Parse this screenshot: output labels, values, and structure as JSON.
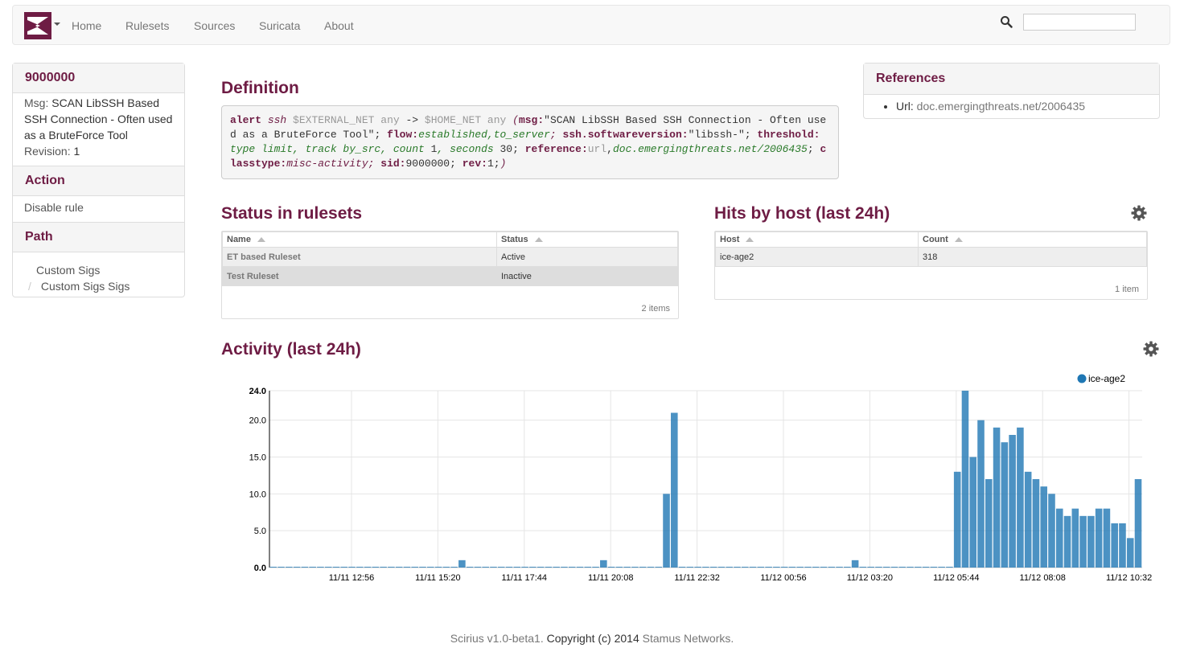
{
  "nav": {
    "items": [
      "Home",
      "Rulesets",
      "Sources",
      "Suricata",
      "About"
    ],
    "search_placeholder": ""
  },
  "sidebar": {
    "sid_title": "9000000",
    "msg_label": "Msg:",
    "msg_value": "SCAN LibSSH Based SSH Connection - Often used as a BruteForce Tool",
    "revision_label": "Revision:",
    "revision_value": "1",
    "action_title": "Action",
    "action_item": "Disable rule",
    "path_title": "Path",
    "path_1": "Custom Sigs",
    "path_sep": "/",
    "path_2": "Custom Sigs Sigs"
  },
  "definition": {
    "title": "Definition",
    "tokens": {
      "alert": "alert",
      "proto": "ssh",
      "src": "$EXTERNAL_NET any",
      "arrow": "->",
      "dst": "$HOME_NET any",
      "open": "(",
      "msg_key": "msg:",
      "msg_val": "\"SCAN LibSSH Based SSH Connection - Often used as a BruteForce Tool\"",
      "semi1": ";",
      "flow_key": "flow:",
      "flow_val": "established,to_server",
      "semi2": ";",
      "sw_key": "ssh.softwareversion:",
      "sw_val": "\"libssh-\"",
      "semi3": ";",
      "thr_key": "threshold:",
      "thr_val1": "type limit, track by_src, count",
      "thr_num1": "1",
      "thr_val2": ", seconds",
      "thr_num2": "30",
      "semi4": ";",
      "ref_key": "reference:",
      "ref_type": "url",
      "ref_comma": ",",
      "ref_val": "doc.emergingthreats.net/2006435",
      "semi5": ";",
      "ct_key": "classtype:",
      "ct_val": "misc-activity",
      "semi6": ";",
      "sid_key": "sid:",
      "sid_val": "9000000",
      "semi7": ";",
      "rev_key": "rev:",
      "rev_val": "1",
      "semi8": ";",
      "close": ")"
    }
  },
  "references": {
    "title": "References",
    "url_label": "Url:",
    "url_value": "doc.emergingthreats.net/2006435"
  },
  "status": {
    "title": "Status in rulesets",
    "headers": [
      "Name",
      "Status"
    ],
    "rows": [
      [
        "ET based Ruleset",
        "Active"
      ],
      [
        "Test Ruleset",
        "Inactive"
      ]
    ],
    "footer": "2 items"
  },
  "hits": {
    "title": "Hits by host (last 24h)",
    "headers": [
      "Host",
      "Count"
    ],
    "rows": [
      [
        "ice-age2",
        "318"
      ]
    ],
    "footer": "1 item"
  },
  "activity": {
    "title": "Activity (last 24h)"
  },
  "chart_data": {
    "type": "bar",
    "series": [
      {
        "name": "ice-age2",
        "color": "#1f77b4",
        "values": [
          0,
          0,
          0,
          0,
          0,
          0,
          0,
          0,
          0,
          0,
          0,
          0,
          0,
          0,
          0,
          0,
          0,
          0,
          0,
          0,
          0,
          0,
          0,
          0,
          1,
          0,
          0,
          0,
          0,
          0,
          0,
          0,
          0,
          0,
          0,
          0,
          0,
          0,
          0,
          0,
          0,
          0,
          1,
          0,
          0,
          0,
          0,
          0,
          0,
          0,
          10,
          21,
          0,
          0,
          0,
          0,
          0,
          0,
          0,
          0,
          0,
          0,
          0,
          0,
          0,
          0,
          0,
          0,
          0,
          0,
          0,
          0,
          0,
          0,
          1,
          0,
          0,
          0,
          0,
          0,
          0,
          0,
          0,
          0,
          0,
          0,
          0,
          13,
          24,
          15,
          20,
          12,
          19,
          17,
          18,
          19,
          13,
          12,
          11,
          10,
          8,
          7,
          8,
          7,
          7,
          8,
          8,
          6,
          6,
          4,
          12
        ]
      }
    ],
    "x_tick_labels": [
      "11/11 12:56",
      "11/11 15:20",
      "11/11 17:44",
      "11/11 20:08",
      "11/11 22:32",
      "11/12 00:56",
      "11/12 03:20",
      "11/12 05:44",
      "11/12 08:08",
      "11/12 10:32"
    ],
    "y_tick_labels": [
      "0.0",
      "5.0",
      "10.0",
      "15.0",
      "20.0",
      "24.0"
    ],
    "ylim": [
      0,
      24
    ],
    "legend": [
      "ice-age2"
    ],
    "legend_position": "top-right",
    "grid": true
  },
  "footer": {
    "version": "Scirius v1.0-beta1",
    "dot": ".",
    "copyright": " Copyright (c) 2014 ",
    "company": "Stamus Networks",
    "end": "."
  },
  "colors": {
    "brand": "#6e1c44",
    "bar": "#1f77b4"
  }
}
